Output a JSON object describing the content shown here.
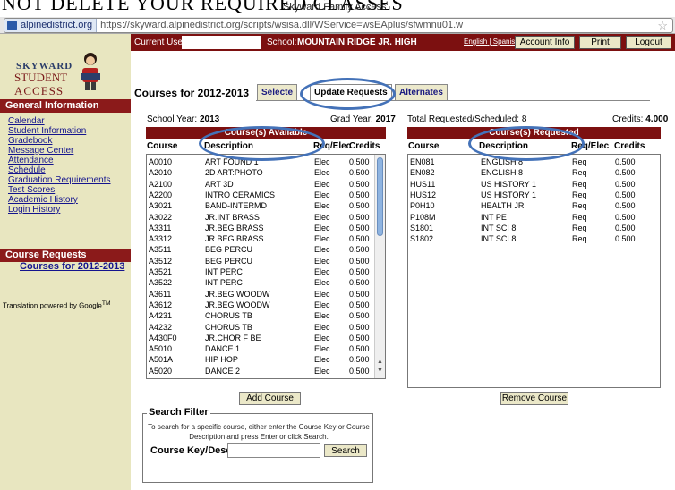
{
  "overlay_banner": "NOT DELETE YOUR REQUIRED CLASSES",
  "window_title": "Skyward Family Access",
  "url": {
    "domain": "alpinedistrict.org",
    "full": "https://skyward.alpinedistrict.org/scripts/wsisa.dll/WService=wsEAplus/sfwmnu01.w"
  },
  "logo": {
    "line1": "SKYWARD",
    "line2": "STUDENT",
    "line3": "ACCESS"
  },
  "sidebar": {
    "general_header": "General Information",
    "links": [
      "Calendar",
      "Student Information",
      "Gradebook",
      "Message Center",
      "Attendance",
      "Schedule",
      "Graduation Requirements",
      "Test Scores",
      "Academic History",
      "Login History"
    ],
    "requests_header": "Course Requests",
    "requests_link": "Courses for 2012-2013",
    "translation": "Translation powered by Google",
    "tm": "TM"
  },
  "topbar": {
    "current_user_label": "Current User:",
    "school_label": "School:",
    "school_name": "MOUNTAIN RIDGE JR. HIGH",
    "lang_en": "English",
    "lang_sep": "|",
    "lang_es": "Spanish",
    "account_info": "Account Info",
    "print": "Print",
    "logout": "Logout"
  },
  "main": {
    "title": "Courses for 2012-2013",
    "tabs": [
      "Selecte",
      "Update Requests",
      "Alternates"
    ],
    "school_year_label": "School Year:",
    "school_year": "2013",
    "grad_year_label": "Grad Year:",
    "grad_year": "2017",
    "total_label": "Total Requested/Scheduled: 8",
    "credits_label": "Credits:",
    "credits": "4.000"
  },
  "available": {
    "header": "Course(s) Available",
    "columns": [
      "Course",
      "Description",
      "Req/Elec",
      "Credits"
    ],
    "rows": [
      [
        "A0010",
        "ART FOUND 1",
        "Elec",
        "0.500"
      ],
      [
        "A2010",
        "2D ART:PHOTO",
        "Elec",
        "0.500"
      ],
      [
        "A2100",
        "ART 3D",
        "Elec",
        "0.500"
      ],
      [
        "A2200",
        "INTRO CERAMICS",
        "Elec",
        "0.500"
      ],
      [
        "A3021",
        "BAND-INTERMD",
        "Elec",
        "0.500"
      ],
      [
        "A3022",
        "JR.INT BRASS",
        "Elec",
        "0.500"
      ],
      [
        "A3311",
        "JR.BEG BRASS",
        "Elec",
        "0.500"
      ],
      [
        "A3312",
        "JR.BEG BRASS",
        "Elec",
        "0.500"
      ],
      [
        "A3511",
        "BEG PERCU",
        "Elec",
        "0.500"
      ],
      [
        "A3512",
        "BEG PERCU",
        "Elec",
        "0.500"
      ],
      [
        "A3521",
        "INT PERC",
        "Elec",
        "0.500"
      ],
      [
        "A3522",
        "INT PERC",
        "Elec",
        "0.500"
      ],
      [
        "A3611",
        "JR.BEG WOODW",
        "Elec",
        "0.500"
      ],
      [
        "A3612",
        "JR.BEG WOODW",
        "Elec",
        "0.500"
      ],
      [
        "A4231",
        "CHORUS TB",
        "Elec",
        "0.500"
      ],
      [
        "A4232",
        "CHORUS TB",
        "Elec",
        "0.500"
      ],
      [
        "A430F0",
        "JR.CHOR F BE",
        "Elec",
        "0.500"
      ],
      [
        "A5010",
        "DANCE 1",
        "Elec",
        "0.500"
      ],
      [
        "A501A",
        "HIP HOP",
        "Elec",
        "0.500"
      ],
      [
        "A5020",
        "DANCE 2",
        "Elec",
        "0.500"
      ]
    ],
    "add_button": "Add Course"
  },
  "requested": {
    "header": "Course(s) Requested",
    "columns": [
      "Course",
      "Description",
      "Req/Elec",
      "Credits"
    ],
    "rows": [
      [
        "EN081",
        "ENGLISH 8",
        "Req",
        "0.500"
      ],
      [
        "EN082",
        "ENGLISH 8",
        "Req",
        "0.500"
      ],
      [
        "HUS11",
        "US HISTORY 1",
        "Req",
        "0.500"
      ],
      [
        "HUS12",
        "US HISTORY 1",
        "Req",
        "0.500"
      ],
      [
        "P0H10",
        "HEALTH JR",
        "Req",
        "0.500"
      ],
      [
        "P108M",
        "INT PE",
        "Req",
        "0.500"
      ],
      [
        "S1801",
        "INT SCI 8",
        "Req",
        "0.500"
      ],
      [
        "S1802",
        "INT SCI 8",
        "Req",
        "0.500"
      ]
    ],
    "remove_button": "Remove Course"
  },
  "filter": {
    "legend": "Search Filter",
    "instructions": "To search for a specific course, either enter the Course Key or Course Description and press Enter or click Search.",
    "label": "Course Key/Desc:",
    "value": "",
    "button": "Search"
  }
}
